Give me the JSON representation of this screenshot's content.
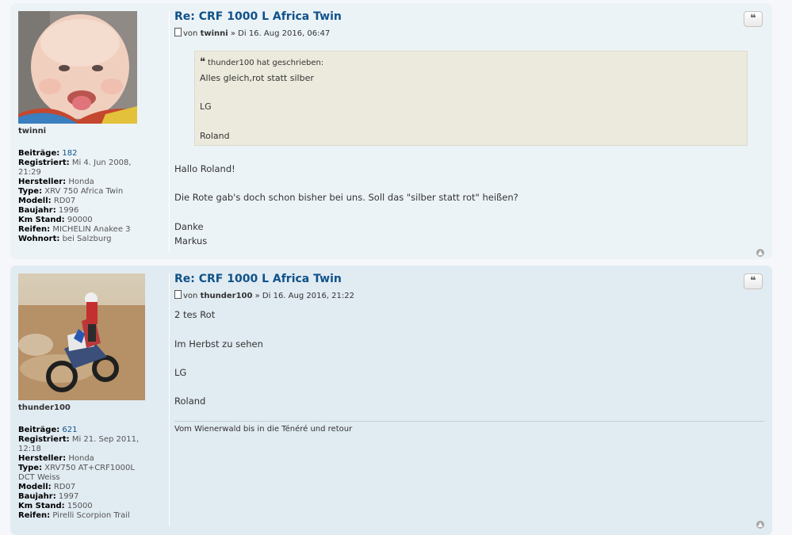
{
  "posts": [
    {
      "title": "Re: CRF 1000 L Africa Twin",
      "author_prefix": "von ",
      "author": "twinni",
      "date": " » Di 16. Aug 2016, 06:47",
      "quote_button": "❝",
      "username": "twinni",
      "profile": {
        "beitraege_label": "Beiträge:",
        "beitraege": "182",
        "registriert_label": "Registriert:",
        "registriert": "Mi 4. Jun 2008, 21:29",
        "hersteller_label": "Hersteller:",
        "hersteller": "Honda",
        "type_label": "Type:",
        "type": "XRV 750 Africa Twin",
        "modell_label": "Modell:",
        "modell": "RD07",
        "baujahr_label": "Baujahr:",
        "baujahr": "1996",
        "km_label": "Km Stand:",
        "km": "90000",
        "reifen_label": "Reifen:",
        "reifen": "MICHELIN Anakee 3",
        "wohnort_label": "Wohnort:",
        "wohnort": "bei Salzburg"
      },
      "quote": {
        "cite": "thunder100 hat geschrieben:",
        "lines": [
          "Alles gleich,rot statt silber",
          "LG",
          "Roland"
        ]
      },
      "content": [
        "Hallo Roland!",
        "Die Rote gab's doch schon bisher bei uns. Soll das \"silber statt rot\" heißen?",
        "Danke",
        "Markus"
      ]
    },
    {
      "title": "Re: CRF 1000 L Africa Twin",
      "author_prefix": "von ",
      "author": "thunder100",
      "date": " » Di 16. Aug 2016, 21:22",
      "quote_button": "❝",
      "username": "thunder100",
      "profile": {
        "beitraege_label": "Beiträge:",
        "beitraege": "621",
        "registriert_label": "Registriert:",
        "registriert": "Mi 21. Sep 2011, 12:18",
        "hersteller_label": "Hersteller:",
        "hersteller": "Honda",
        "type_label": "Type:",
        "type": "XRV750 AT+CRF1000L DCT Weiss",
        "modell_label": "Modell:",
        "modell": "RD07",
        "baujahr_label": "Baujahr:",
        "baujahr": "1997",
        "km_label": "Km Stand:",
        "km": "15000",
        "reifen_label": "Reifen:",
        "reifen": "Pirelli Scorpion Trail"
      },
      "content": [
        "2 tes Rot",
        "Im Herbst zu sehen",
        "LG",
        "Roland"
      ],
      "signature": "Vom Wienerwald bis in die Ténéré und retour"
    }
  ],
  "icons": {
    "top": "top-arrow-icon",
    "post": "post-doc-icon",
    "quote": "quote-icon"
  },
  "colors": {
    "link": "#105289",
    "bg1": "#ecf3f7",
    "bg2": "#e1ebf2",
    "quote_bg": "#ebeadd"
  }
}
